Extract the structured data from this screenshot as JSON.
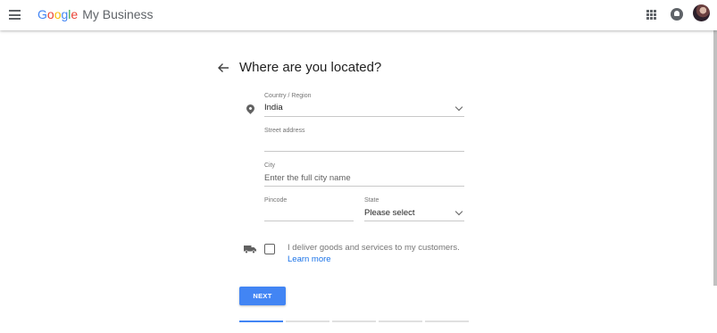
{
  "header": {
    "brand_letters": [
      "G",
      "o",
      "o",
      "g",
      "l",
      "e"
    ],
    "product": "My Business"
  },
  "form": {
    "title": "Where are you located?",
    "country": {
      "label": "Country / Region",
      "value": "India"
    },
    "street": {
      "label": "Street address",
      "value": ""
    },
    "city": {
      "label": "City",
      "placeholder": "Enter the full city name"
    },
    "pincode": {
      "label": "Pincode",
      "value": ""
    },
    "state": {
      "label": "State",
      "value": "Please select"
    },
    "delivery": {
      "text": "I deliver goods and services to my customers.",
      "link": "Learn more",
      "checked": false
    },
    "next_label": "NEXT"
  },
  "progress": {
    "steps": 5,
    "current": 1
  },
  "colors": {
    "accent": "#4285f4",
    "link": "#1a73e8"
  },
  "icons": [
    "menu-icon",
    "apps-icon",
    "notifications-icon",
    "avatar",
    "back-arrow-icon",
    "location-pin-icon",
    "truck-icon",
    "chevron-down-icon"
  ]
}
